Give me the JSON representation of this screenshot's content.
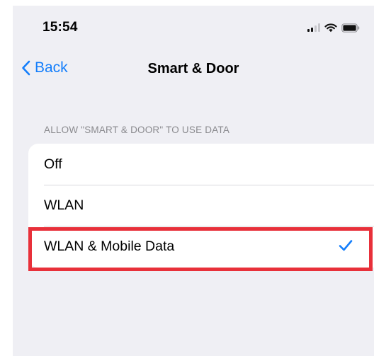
{
  "status_bar": {
    "time": "15:54",
    "icons": [
      "cellular-signal-icon",
      "wifi-icon",
      "battery-icon"
    ]
  },
  "nav": {
    "back_label": "Back",
    "title": "Smart & Door"
  },
  "section": {
    "header": "ALLOW \"SMART & DOOR\" TO USE DATA",
    "options": [
      {
        "label": "Off",
        "selected": false
      },
      {
        "label": "WLAN",
        "selected": false
      },
      {
        "label": "WLAN & Mobile Data",
        "selected": true
      }
    ]
  },
  "colors": {
    "accent": "#147efb",
    "background": "#efeff4",
    "highlight": "#e8303a"
  }
}
